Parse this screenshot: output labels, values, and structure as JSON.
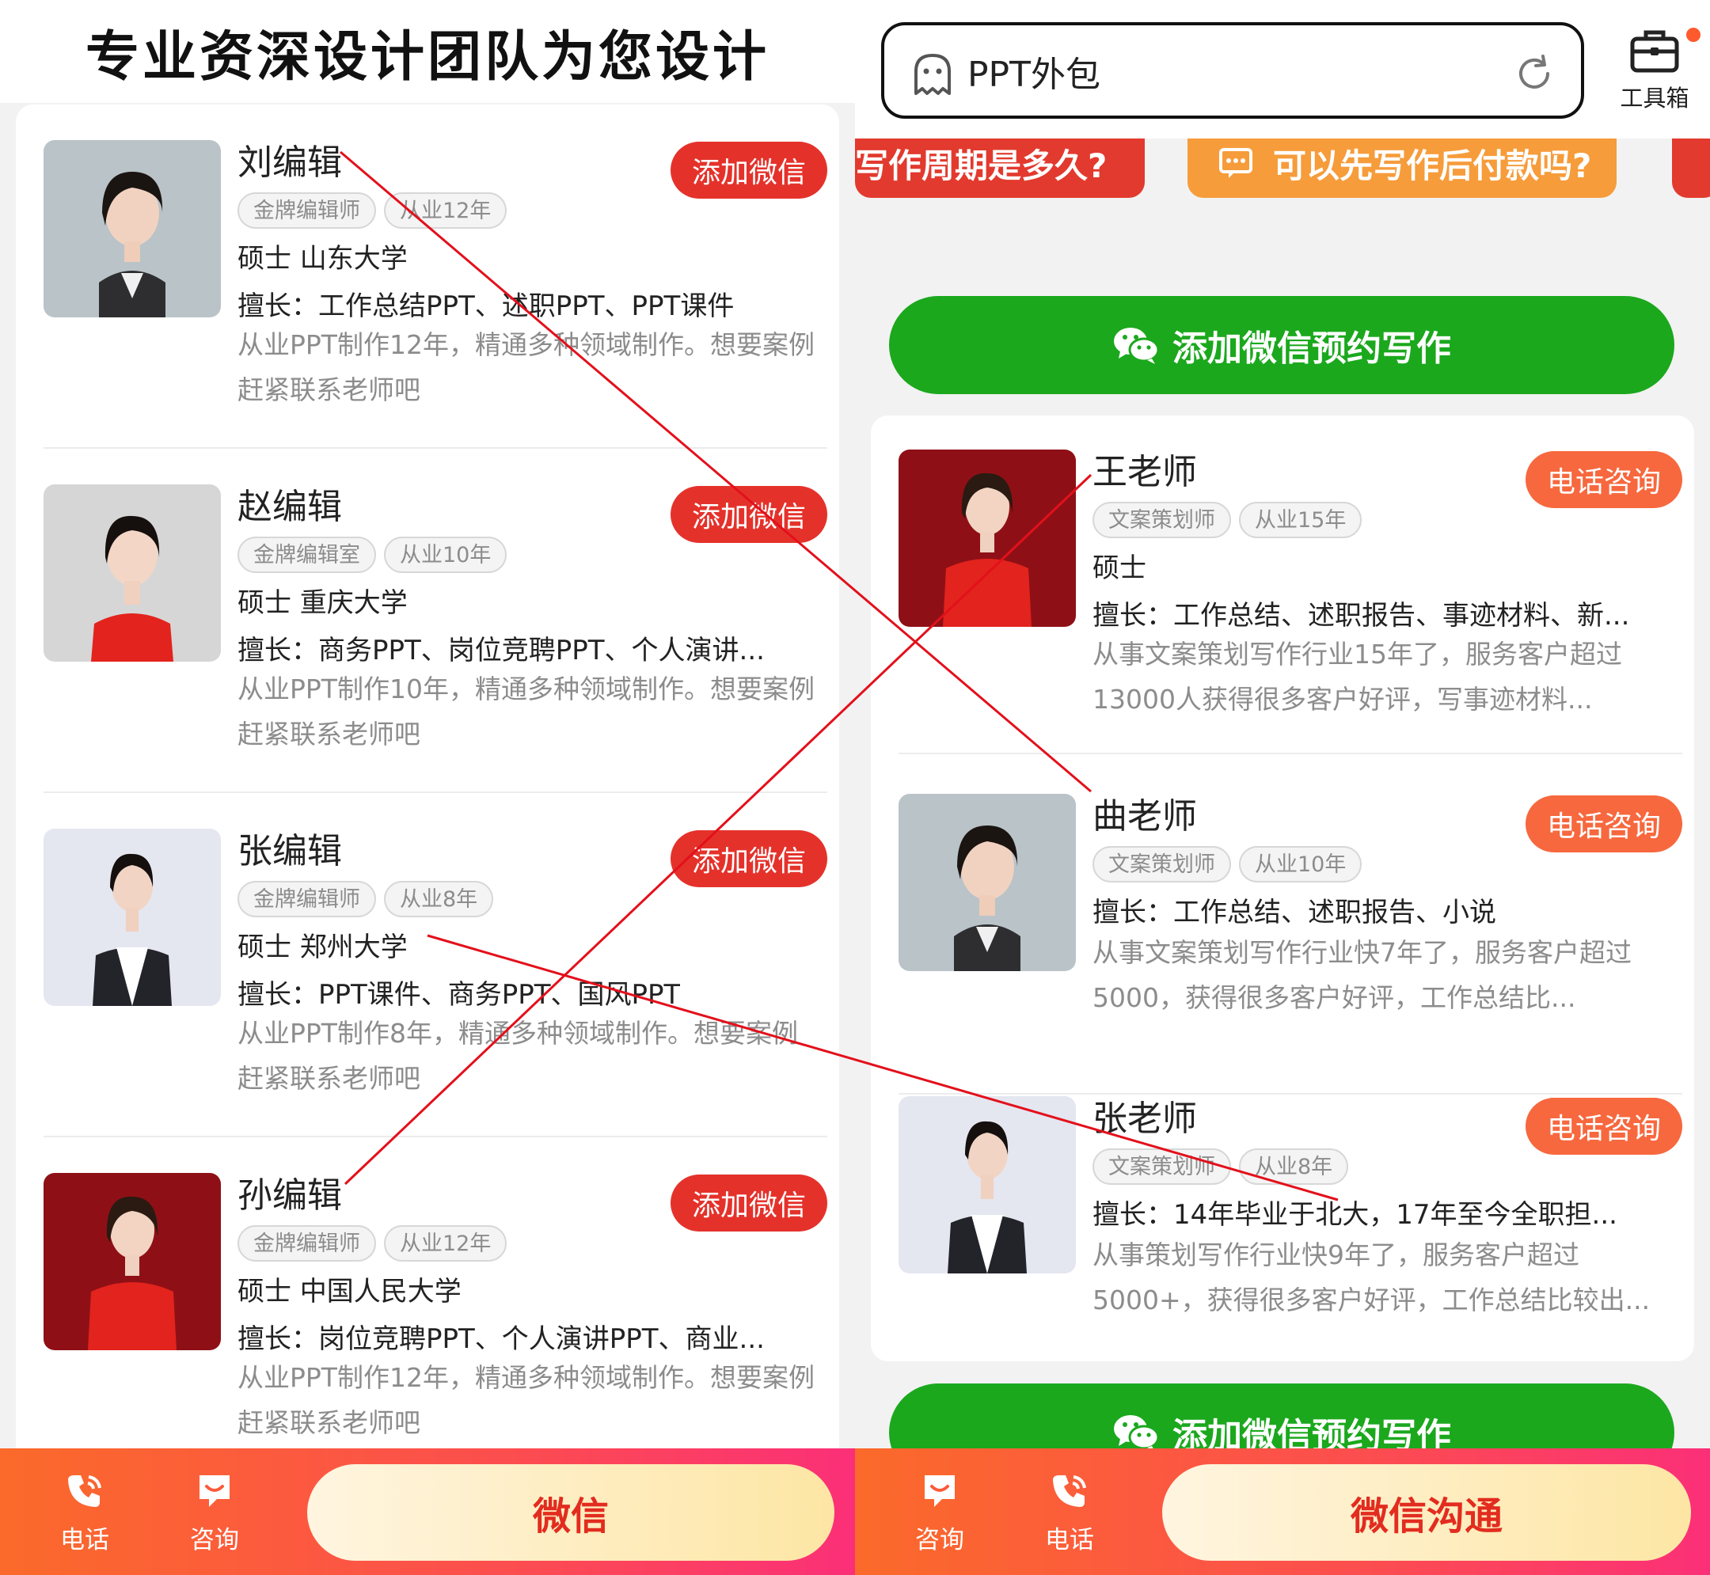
{
  "left": {
    "header_title": "专业资深设计团队为您设计",
    "action_label": "添加微信",
    "editors": [
      {
        "name": "刘编辑",
        "tags": [
          "金牌编辑师",
          "从业12年"
        ],
        "degree": "硕士  山东大学",
        "specialty": "擅长：工作总结PPT、述职PPT、PPT课件",
        "desc": "从业PPT制作12年，精通多种领域制作。想要案例赶紧联系老师吧"
      },
      {
        "name": "赵编辑",
        "tags": [
          "金牌编辑室",
          "从业10年"
        ],
        "degree": "硕士  重庆大学",
        "specialty": "擅长：商务PPT、岗位竞聘PPT、个人演讲...",
        "desc": "从业PPT制作10年，精通多种领域制作。想要案例赶紧联系老师吧"
      },
      {
        "name": "张编辑",
        "tags": [
          "金牌编辑师",
          "从业8年"
        ],
        "degree": "硕士  郑州大学",
        "specialty": "擅长：PPT课件、商务PPT、国风PPT",
        "desc": "从业PPT制作8年，精通多种领域制作。想要案例赶紧联系老师吧"
      },
      {
        "name": "孙编辑",
        "tags": [
          "金牌编辑师",
          "从业12年"
        ],
        "degree": "硕士  中国人民大学",
        "specialty": "擅长：岗位竞聘PPT、个人演讲PPT、商业...",
        "desc": "从业PPT制作12年，精通多种领域制作。想要案例赶紧联系老师吧"
      }
    ],
    "bottom": {
      "tab1": "电话",
      "tab2": "咨询",
      "main_button": "微信"
    }
  },
  "right": {
    "search_value": "PPT外包",
    "toolbox_label": "工具箱",
    "faq": [
      "写作周期是多久?",
      "可以先写作后付款吗?"
    ],
    "green_button": "添加微信预约写作",
    "action_label": "电话咨询",
    "teachers": [
      {
        "name": "王老师",
        "tags": [
          "文案策划师",
          "从业15年"
        ],
        "degree": "硕士",
        "specialty": "擅长：工作总结、述职报告、事迹材料、新...",
        "desc": "从事文案策划写作行业15年了，服务客户超过13000人获得很多客户好评，写事迹材料..."
      },
      {
        "name": "曲老师",
        "tags": [
          "文案策划师",
          "从业10年"
        ],
        "specialty": "擅长：工作总结、述职报告、小说",
        "desc": "从事文案策划写作行业快7年了，服务客户超过5000，获得很多客户好评，工作总结比..."
      },
      {
        "name": "张老师",
        "tags": [
          "文案策划师",
          "从业8年"
        ],
        "specialty": "擅长：14年毕业于北大，17年至今全职担...",
        "desc": "从事策划写作行业快9年了，服务客户超过5000+，获得很多客户好评，工作总结比较出..."
      }
    ],
    "bottom": {
      "tab1": "咨询",
      "tab2": "电话",
      "main_button": "微信沟通"
    }
  },
  "colors": {
    "red": "#e4322b",
    "orange": "#f7683e",
    "green": "#1ba81d",
    "overlay_line": "#e3101b"
  }
}
